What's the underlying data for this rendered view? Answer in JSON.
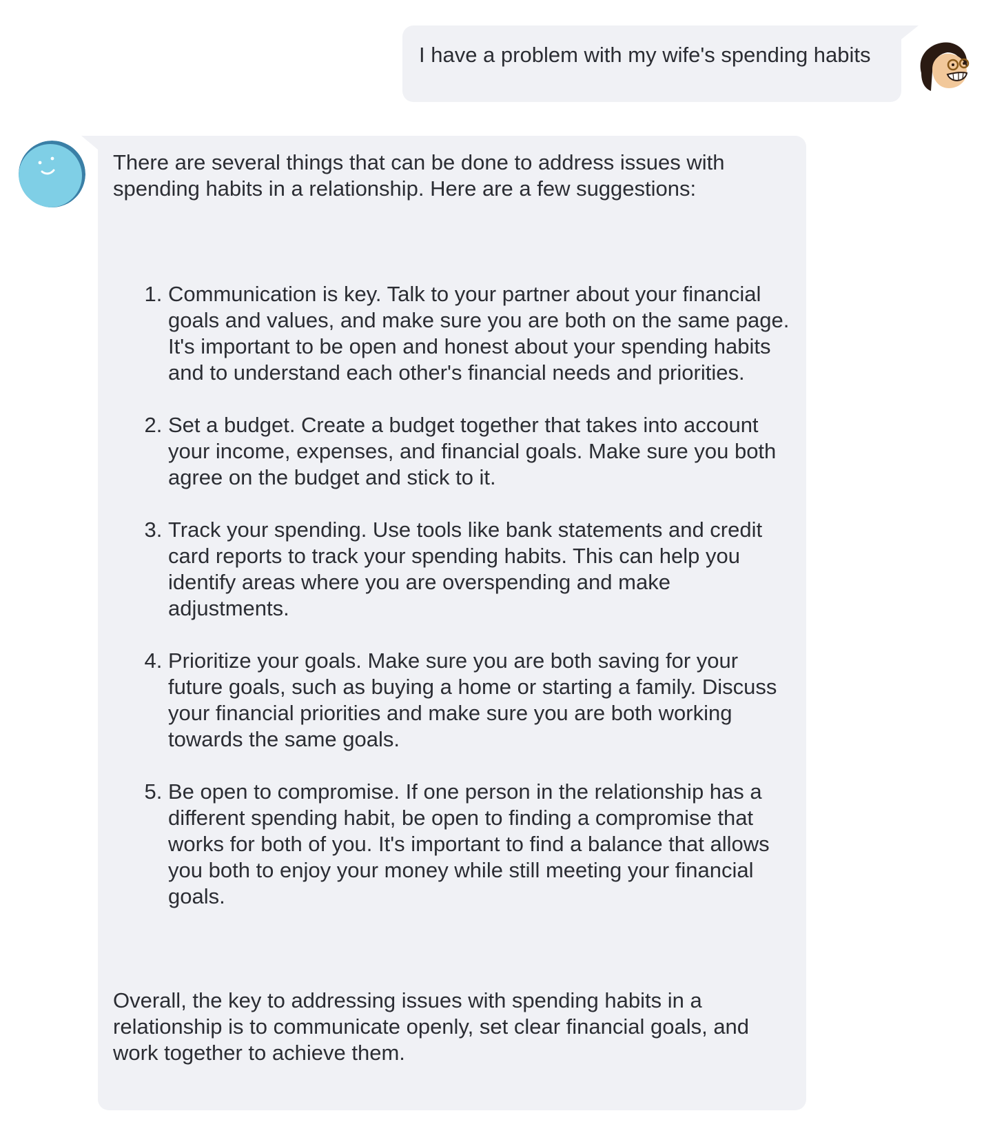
{
  "conversation": {
    "user_message": {
      "avatar_icon": "user-cartoon-avatar-icon",
      "text": "I have a problem with my wife's spending habits"
    },
    "assistant_message": {
      "avatar_icon": "smiley-bot-avatar-icon",
      "intro": "There are several things that can be done to address issues with spending habits in a relationship. Here are a few suggestions:",
      "items": [
        "Communication is key. Talk to your partner about your financial goals and values, and make sure you are both on the same page. It's important to be open and honest about your spending habits and to understand each other's financial needs and priorities.",
        "Set a budget. Create a budget together that takes into account your income, expenses, and financial goals. Make sure you both agree on the budget and stick to it.",
        "Track your spending. Use tools like bank statements and credit card reports to track your spending habits. This can help you identify areas where you are overspending and make adjustments.",
        "Prioritize your goals. Make sure you are both saving for your future goals, such as buying a home or starting a family. Discuss your financial priorities and make sure you are both working towards the same goals.",
        "Be open to compromise. If one person in the relationship has a different spending habit, be open to finding a compromise that works for both of you. It's important to find a balance that allows you both to enjoy your money while still meeting your financial goals."
      ],
      "outro": "Overall, the key to addressing issues with spending habits in a relationship is to communicate openly, set clear financial goals, and work together to achieve them."
    }
  },
  "colors": {
    "bubble_bg": "#f0f1f5",
    "text": "#2b2d33",
    "bot_avatar_fill": "#7fcfe6",
    "bot_avatar_ring": "#3a7fa6"
  }
}
